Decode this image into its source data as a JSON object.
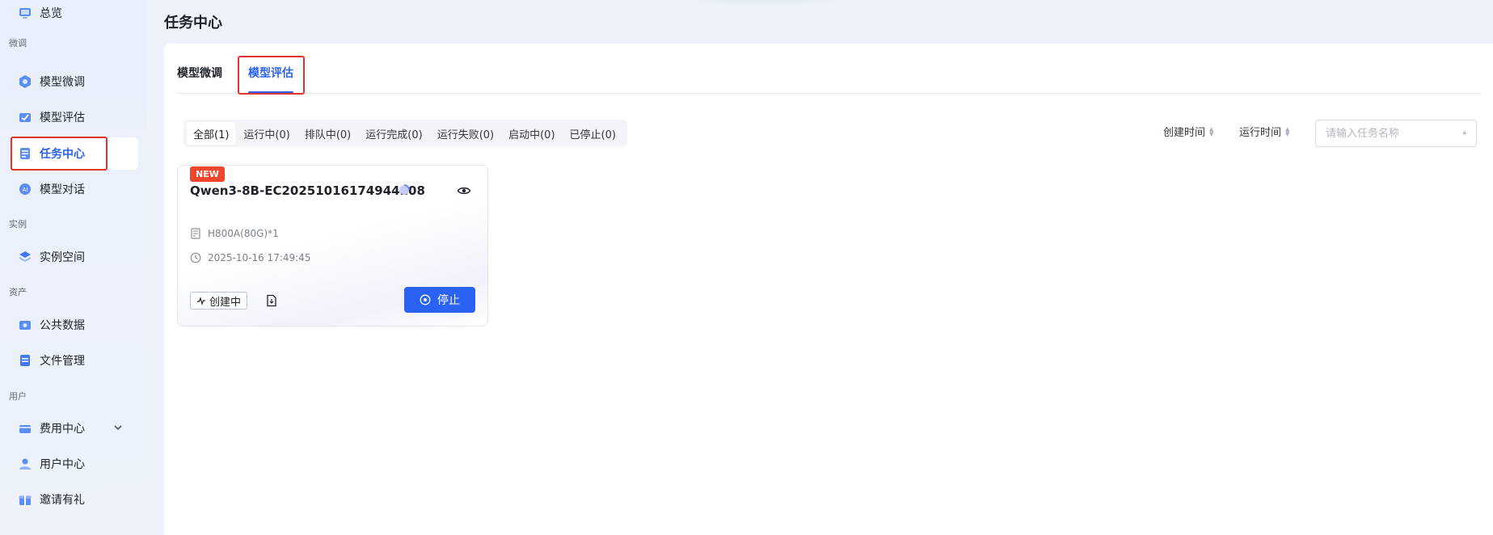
{
  "sidebar": {
    "items": [
      {
        "label": "总览",
        "icon": "overview-icon"
      },
      {
        "label": "模型微调",
        "icon": "finetune-icon"
      },
      {
        "label": "模型评估",
        "icon": "evaluate-icon"
      },
      {
        "label": "任务中心",
        "icon": "task-center-icon",
        "active": true
      },
      {
        "label": "模型对话",
        "icon": "chat-icon"
      },
      {
        "label": "实例空间",
        "icon": "instance-icon"
      },
      {
        "label": "公共数据",
        "icon": "public-data-icon"
      },
      {
        "label": "文件管理",
        "icon": "file-icon"
      },
      {
        "label": "费用中心",
        "icon": "billing-icon",
        "expandable": true
      },
      {
        "label": "用户中心",
        "icon": "user-icon"
      },
      {
        "label": "邀请有礼",
        "icon": "gift-icon"
      }
    ],
    "groups": [
      "微调",
      "实例",
      "资产",
      "用户"
    ]
  },
  "header": {
    "title": "任务中心"
  },
  "tabs": [
    {
      "label": "模型微调"
    },
    {
      "label": "模型评估",
      "active": true
    }
  ],
  "filters": [
    {
      "label": "全部(1)",
      "active": true
    },
    {
      "label": "运行中(0)"
    },
    {
      "label": "排队中(0)"
    },
    {
      "label": "运行完成(0)"
    },
    {
      "label": "运行失败(0)"
    },
    {
      "label": "启动中(0)"
    },
    {
      "label": "已停止(0)"
    }
  ],
  "sort": {
    "created": "创建时间",
    "runtime": "运行时间"
  },
  "search": {
    "placeholder": "请输入任务名称",
    "value": ""
  },
  "card": {
    "badge": "NEW",
    "title": "Qwen3-8B-EC20251016174944208",
    "gpu": "H800A(80G)*1",
    "time": "2025-10-16 17:49:45",
    "status": "创建中",
    "stop_label": "停止"
  },
  "colors": {
    "accent": "#2a62f3",
    "highlight": "#e1352b",
    "badge": "#f0462e"
  }
}
